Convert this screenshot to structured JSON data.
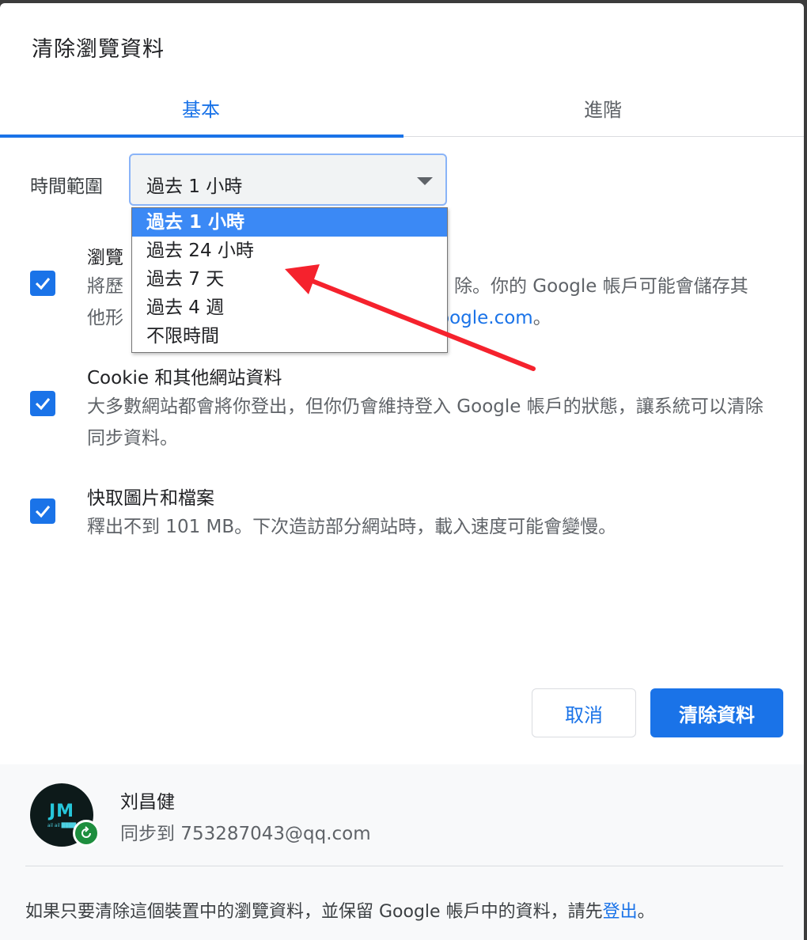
{
  "dialog": {
    "title": "清除瀏覽資料",
    "tabs": [
      "基本",
      "進階"
    ]
  },
  "time_range": {
    "label": "時間範圍",
    "selected": "過去 1 小時",
    "options": [
      "過去 1 小時",
      "過去 24 小時",
      "過去 7 天",
      "過去 4 週",
      "不限時間"
    ]
  },
  "items": [
    {
      "title": "瀏覽",
      "desc_line1_left": "將歷",
      "desc_line1_right": "除。你的 Google 帳戶可能會儲存其",
      "desc_line2_left": "他形",
      "desc_line2_link": "oogle.com",
      "desc_line2_right": "。",
      "checked": true
    },
    {
      "title": "Cookie 和其他網站資料",
      "desc": "大多數網站都會將你登出，但你仍會維持登入 Google 帳戶的狀態，讓系統可以清除同步資料。",
      "checked": true
    },
    {
      "title": "快取圖片和檔案",
      "desc": "釋出不到 101 MB。下次造訪部分網站時，載入速度可能會變慢。",
      "checked": true
    }
  ],
  "buttons": {
    "cancel": "取消",
    "clear": "清除資料"
  },
  "account": {
    "avatar_initials": "JM",
    "avatar_subtext": "ail ail ████",
    "name": "刘昌健",
    "sync_text": "同步到 753287043@qq.com"
  },
  "footer_note": {
    "text": "如果只要清除這個裝置中的瀏覽資料，並保留 Google 帳戶中的資料，請先",
    "link": "登出",
    "end": "。"
  },
  "colors": {
    "accent": "#1a73e8",
    "annotation_arrow": "#f5222d",
    "sync_badge": "#1e8e3e"
  }
}
